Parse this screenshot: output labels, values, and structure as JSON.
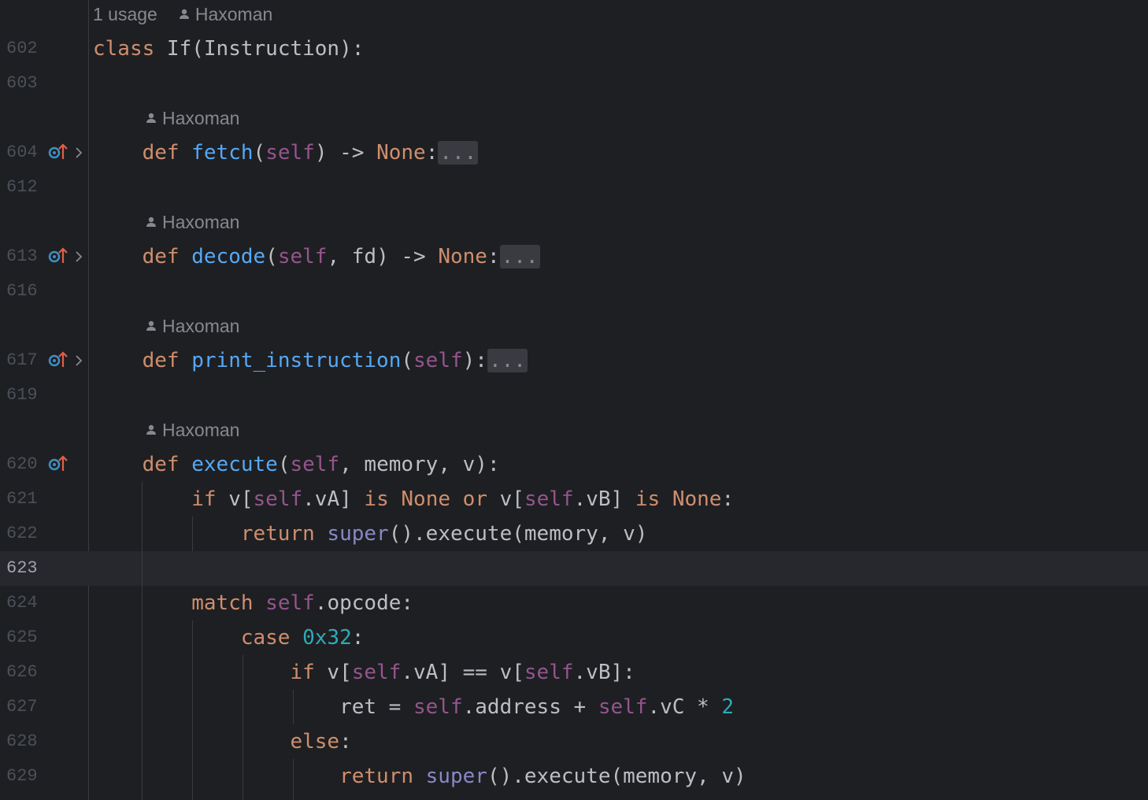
{
  "editor": {
    "class_hint": {
      "usage": "1 usage",
      "author": "Haxoman"
    },
    "author_hints": {
      "fetch": "Haxoman",
      "decode": "Haxoman",
      "print_instruction": "Haxoman",
      "execute": "Haxoman"
    },
    "lines": [
      {
        "number": "602",
        "text": "class If(Instruction):"
      },
      {
        "number": "603",
        "text": ""
      },
      {
        "number": "604",
        "text": "    def fetch(self) -> None:..."
      },
      {
        "number": "612",
        "text": ""
      },
      {
        "number": "613",
        "text": "    def decode(self, fd) -> None:..."
      },
      {
        "number": "616",
        "text": ""
      },
      {
        "number": "617",
        "text": "    def print_instruction(self):..."
      },
      {
        "number": "619",
        "text": ""
      },
      {
        "number": "620",
        "text": "    def execute(self, memory, v):"
      },
      {
        "number": "621",
        "text": "        if v[self.vA] is None or v[self.vB] is None:"
      },
      {
        "number": "622",
        "text": "            return super().execute(memory, v)"
      },
      {
        "number": "623",
        "text": ""
      },
      {
        "number": "624",
        "text": "        match self.opcode:"
      },
      {
        "number": "625",
        "text": "            case 0x32:"
      },
      {
        "number": "626",
        "text": "                if v[self.vA] == v[self.vB]:"
      },
      {
        "number": "627",
        "text": "                    ret = self.address + self.vC * 2"
      },
      {
        "number": "628",
        "text": "                else:"
      },
      {
        "number": "629",
        "text": "                    return super().execute(memory, v)"
      }
    ],
    "current_line": "623",
    "gutter_icons": {
      "override": "override-method-icon",
      "fold": "fold-chevron-icon"
    },
    "colors": {
      "background": "#1e1f22",
      "keyword": "#cf8e6d",
      "function": "#56a8f5",
      "self": "#94558d",
      "builtin": "#8888c6",
      "number": "#2aacb8",
      "text": "#bcbec4"
    }
  }
}
